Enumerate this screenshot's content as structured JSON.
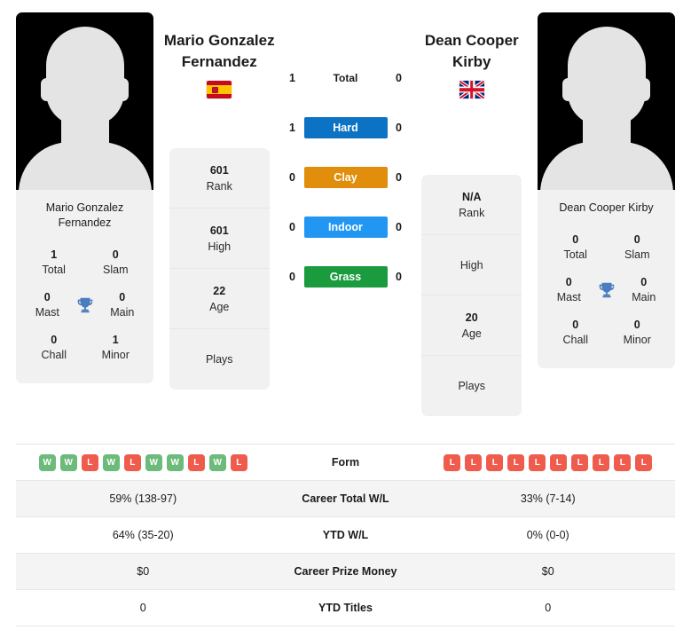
{
  "players": {
    "left": {
      "name": "Mario Gonzalez Fernandez",
      "card_name": "Mario Gonzalez Fernandez",
      "country_code": "es",
      "country_name": "Spain",
      "titles": [
        {
          "value": "1",
          "label": "Total"
        },
        {
          "value": "0",
          "label": "Slam"
        },
        {
          "value": "0",
          "label": "Mast"
        },
        {
          "value": "0",
          "label": "Main"
        },
        {
          "value": "0",
          "label": "Chall"
        },
        {
          "value": "1",
          "label": "Minor"
        }
      ],
      "profile": [
        {
          "value": "601",
          "label": "Rank"
        },
        {
          "value": "601",
          "label": "High"
        },
        {
          "value": "22",
          "label": "Age"
        },
        {
          "value": "",
          "label": "Plays"
        }
      ],
      "form": [
        "W",
        "W",
        "L",
        "W",
        "L",
        "W",
        "W",
        "L",
        "W",
        "L"
      ],
      "career_total_wl": "59% (138-97)",
      "ytd_wl": "64% (35-20)",
      "career_prize_money": "$0",
      "ytd_titles": "0"
    },
    "right": {
      "name": "Dean Cooper Kirby",
      "card_name": "Dean Cooper Kirby",
      "country_code": "gb",
      "country_name": "United Kingdom",
      "titles": [
        {
          "value": "0",
          "label": "Total"
        },
        {
          "value": "0",
          "label": "Slam"
        },
        {
          "value": "0",
          "label": "Mast"
        },
        {
          "value": "0",
          "label": "Main"
        },
        {
          "value": "0",
          "label": "Chall"
        },
        {
          "value": "0",
          "label": "Minor"
        }
      ],
      "profile": [
        {
          "value": "N/A",
          "label": "Rank"
        },
        {
          "value": "",
          "label": "High"
        },
        {
          "value": "20",
          "label": "Age"
        },
        {
          "value": "",
          "label": "Plays"
        }
      ],
      "form": [
        "L",
        "L",
        "L",
        "L",
        "L",
        "L",
        "L",
        "L",
        "L",
        "L"
      ],
      "career_total_wl": "33% (7-14)",
      "ytd_wl": "0% (0-0)",
      "career_prize_money": "$0",
      "ytd_titles": "0"
    }
  },
  "surfaces": [
    {
      "label": "Total",
      "left": "1",
      "right": "0",
      "color": "transparent"
    },
    {
      "label": "Hard",
      "left": "1",
      "right": "0",
      "color": "#0b72c4"
    },
    {
      "label": "Clay",
      "left": "0",
      "right": "0",
      "color": "#e08e0b"
    },
    {
      "label": "Indoor",
      "left": "0",
      "right": "0",
      "color": "#2196f3"
    },
    {
      "label": "Grass",
      "left": "0",
      "right": "0",
      "color": "#199b3e"
    }
  ],
  "stats_rows": [
    {
      "label": "Form",
      "left": "",
      "right": "",
      "type": "form"
    },
    {
      "label": "Career Total W/L",
      "left": "59% (138-97)",
      "right": "33% (7-14)",
      "type": "text"
    },
    {
      "label": "YTD W/L",
      "left": "64% (35-20)",
      "right": "0% (0-0)",
      "type": "text"
    },
    {
      "label": "Career Prize Money",
      "left": "$0",
      "right": "$0",
      "type": "text"
    },
    {
      "label": "YTD Titles",
      "left": "0",
      "right": "0",
      "type": "text"
    }
  ],
  "colors": {
    "hard": "#0b72c4",
    "clay": "#e08e0b",
    "indoor": "#2196f3",
    "grass": "#199b3e",
    "win_badge": "#6cbb7b",
    "loss_badge": "#ef5b4c",
    "panel_bg": "#f1f1f1"
  }
}
